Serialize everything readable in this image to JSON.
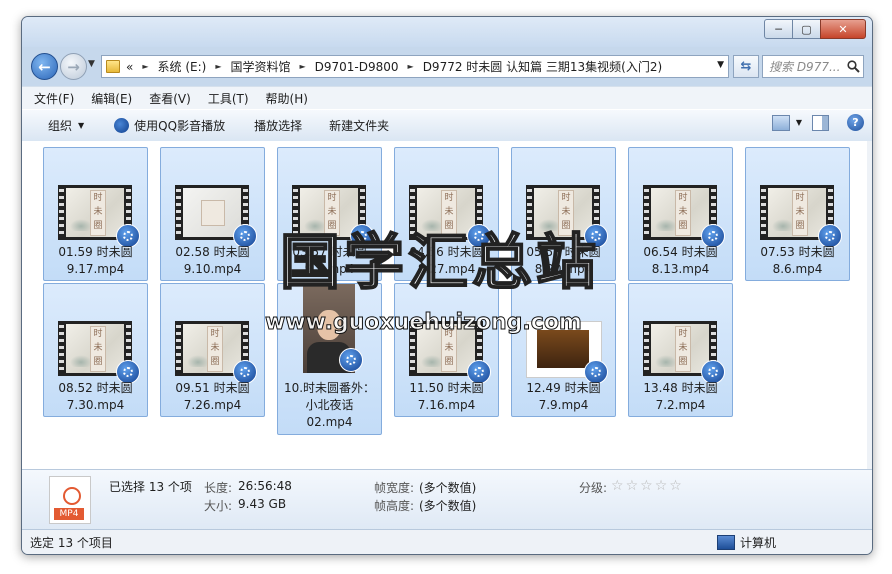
{
  "window": {
    "controls": {
      "minimize": "─",
      "maximize": "▢",
      "close": "✕"
    }
  },
  "address": {
    "overflow": "«",
    "crumbs": [
      "系统 (E:)",
      "国学资料馆",
      "D9701-D9800",
      "D9772 时未圆 认知篇 三期13集视频(入门2)"
    ]
  },
  "search": {
    "placeholder": "搜索 D977..."
  },
  "menu": [
    "文件(F)",
    "编辑(E)",
    "查看(V)",
    "工具(T)",
    "帮助(H)"
  ],
  "toolbar": {
    "organize": "组织",
    "play_qq": "使用QQ影音播放",
    "play_selection": "播放选择",
    "new_folder": "新建文件夹"
  },
  "thumb_text": [
    "时",
    "未",
    "圈"
  ],
  "files": [
    {
      "line1": "01.59 时未圆",
      "line2": "9.17.mp4",
      "line3": ""
    },
    {
      "line1": "02.58 时未圆",
      "line2": "9.10.mp4",
      "line3": ""
    },
    {
      "line1": "03.57 时未圆",
      "line2": "9.3.mp4",
      "line3": ""
    },
    {
      "line1": "04.56 时未圆",
      "line2": "8.27.mp4",
      "line3": ""
    },
    {
      "line1": "05.55 时未圆",
      "line2": "8.20.mp4",
      "line3": ""
    },
    {
      "line1": "06.54 时未圆",
      "line2": "8.13.mp4",
      "line3": ""
    },
    {
      "line1": "07.53 时未圆",
      "line2": "8.6.mp4",
      "line3": ""
    },
    {
      "line1": "08.52 时未圆",
      "line2": "7.30.mp4",
      "line3": ""
    },
    {
      "line1": "09.51 时未圆",
      "line2": "7.26.mp4",
      "line3": ""
    },
    {
      "line1": "10.时未圆番外：",
      "line2": "小北夜话",
      "line3": "02.mp4"
    },
    {
      "line1": "11.50 时未圆",
      "line2": "7.16.mp4",
      "line3": ""
    },
    {
      "line1": "12.49 时未圆",
      "line2": "7.9.mp4",
      "line3": ""
    },
    {
      "line1": "13.48 时未圆",
      "line2": "7.2.mp4",
      "line3": ""
    }
  ],
  "watermark": {
    "cn": "国学汇总站",
    "url": "www.guoxuehuizong.com"
  },
  "details": {
    "icon_label": "MP4",
    "selected": "已选择 13 个项",
    "length_label": "长度:",
    "length_value": "26:56:48",
    "size_label": "大小:",
    "size_value": "9.43 GB",
    "width_label": "帧宽度:",
    "width_value": "(多个数值)",
    "height_label": "帧高度:",
    "height_value": "(多个数值)",
    "rating_label": "分级:",
    "rating": 0
  },
  "status": {
    "left": "选定 13 个项目",
    "right": "计算机"
  }
}
